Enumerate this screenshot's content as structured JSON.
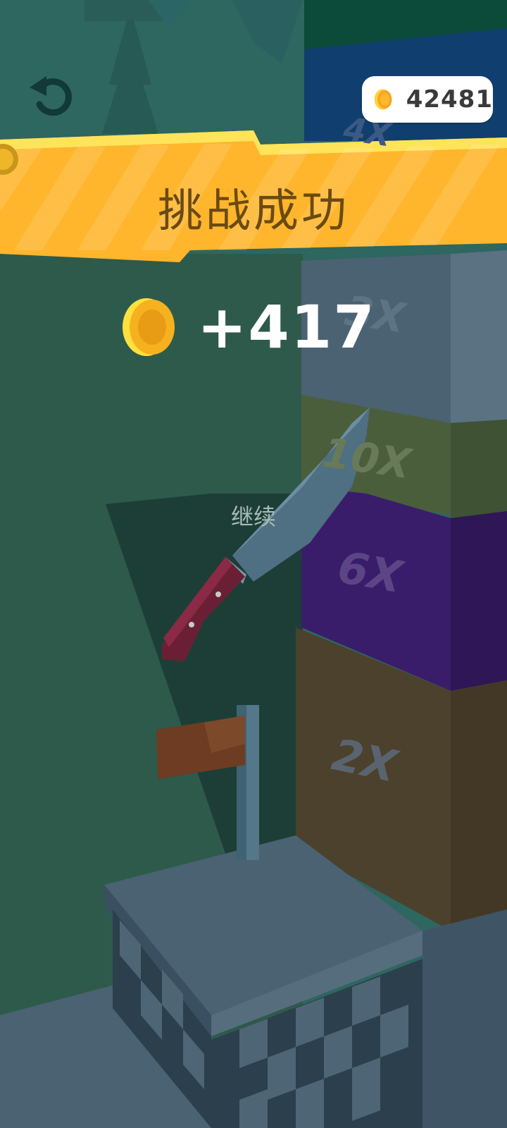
{
  "hud": {
    "coins_total": "42481",
    "undo_icon": "undo-icon"
  },
  "banner": {
    "title": "挑战成功",
    "color": "#ffb62d"
  },
  "reward": {
    "amount": "+417"
  },
  "continue_label": "继续",
  "multipliers": {
    "m4": "4X",
    "m3": "3X",
    "m10": "10X",
    "m6": "6X",
    "m2": "2X"
  },
  "colors": {
    "green_panel": "#2e5a4b",
    "gray_block": "#4b6272",
    "olive_block": "#4b5e3c",
    "purple_block": "#3a1d6a",
    "brown_block": "#4c412c",
    "coin": "#f7b21e"
  }
}
